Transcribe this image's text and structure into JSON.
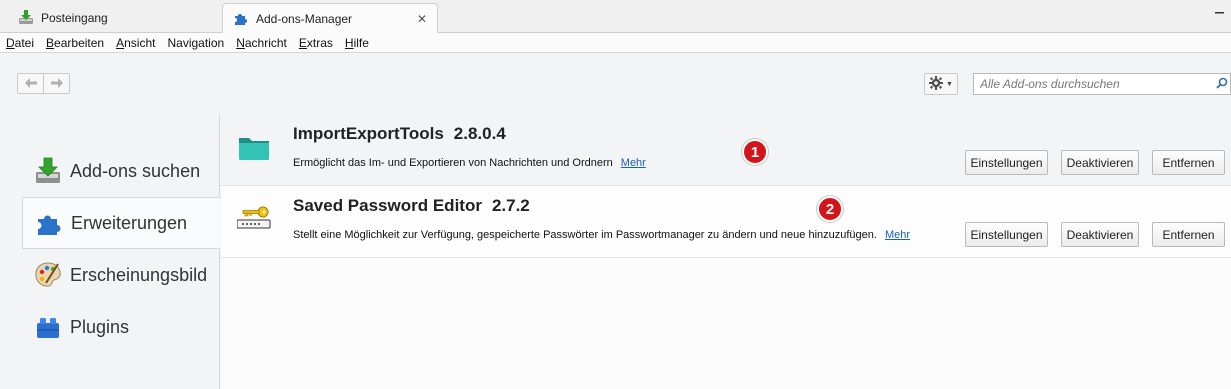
{
  "tabs": [
    {
      "label": "Posteingang",
      "icon": "download-inbox-icon",
      "active": false
    },
    {
      "label": "Add-ons-Manager",
      "icon": "puzzle-icon",
      "active": true,
      "close": "✕"
    }
  ],
  "menubar": {
    "items": [
      {
        "first": "D",
        "rest": "atei"
      },
      {
        "first": "B",
        "rest": "earbeiten"
      },
      {
        "first": "A",
        "rest": "nsicht"
      },
      {
        "first": "N",
        "rest": "avigation",
        "full_prefix": ""
      },
      {
        "first": "N",
        "rest": "achricht"
      },
      {
        "first": "E",
        "rest": "xtras"
      },
      {
        "first": "H",
        "rest": "ilfe"
      }
    ]
  },
  "toolbar": {
    "back_icon": "arrow-left-icon",
    "forward_icon": "arrow-right-icon",
    "tools_icon": "gear-icon",
    "search": {
      "placeholder": "Alle Add-ons durchsuchen",
      "value": ""
    }
  },
  "sidebar": {
    "items": [
      {
        "label": "Add-ons suchen",
        "icon": "download-tray-icon",
        "selected": false
      },
      {
        "label": "Erweiterungen",
        "icon": "puzzle-icon",
        "selected": true
      },
      {
        "label": "Erscheinungsbild",
        "icon": "palette-icon",
        "selected": false
      },
      {
        "label": "Plugins",
        "icon": "lego-block-icon",
        "selected": false
      }
    ]
  },
  "addons": [
    {
      "name": "ImportExportTools",
      "version": "2.8.0.4",
      "description": "Ermöglicht das Im- und Exportieren von Nachrichten und Ordnern",
      "more": "Mehr",
      "icon": "folder-icon",
      "marker": "1",
      "buttons": {
        "settings": "Einstellungen",
        "disable": "Deaktivieren",
        "remove": "Entfernen"
      }
    },
    {
      "name": "Saved Password Editor",
      "version": "2.7.2",
      "description": "Stellt eine Möglichkeit zur Verfügung, gespeicherte Passwörter im Passwortmanager zu ändern und neue hinzuzufügen.",
      "more": "Mehr",
      "icon": "key-icon",
      "marker": "2",
      "buttons": {
        "settings": "Einstellungen",
        "disable": "Deaktivieren",
        "remove": "Entfernen"
      }
    }
  ],
  "colors": {
    "marker": "#d4141b",
    "link": "#1a5fb4",
    "accent": "#1e6fc8"
  }
}
